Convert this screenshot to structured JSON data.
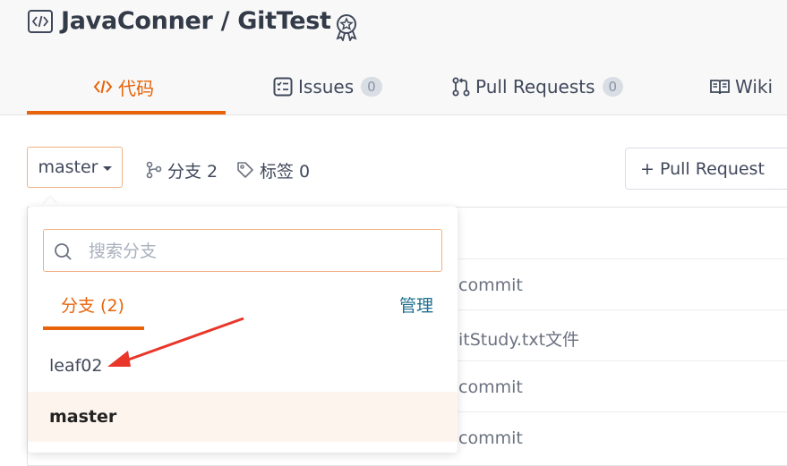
{
  "repo": {
    "title": "JavaConner / GitTest",
    "star_icon": "award-icon"
  },
  "tabs": [
    {
      "label": "代码",
      "icon": "code-icon",
      "active": true
    },
    {
      "label": "Issues",
      "count": "0",
      "icon": "issues-icon"
    },
    {
      "label": "Pull Requests",
      "count": "0",
      "icon": "pull-request-icon"
    },
    {
      "label": "Wiki",
      "icon": "book-icon"
    }
  ],
  "toolbar": {
    "branch_selected": "master",
    "branches_label": "分支 2",
    "tags_label": "标签 0",
    "pr_button": "+ Pull Request"
  },
  "dropdown": {
    "search_placeholder": "搜索分支",
    "tab_label": "分支 (2)",
    "manage_label": "管理",
    "branches": [
      "leaf02",
      "master"
    ],
    "active_branch": "master"
  },
  "commits": [
    {
      "message": "commit"
    },
    {
      "message": "itStudy.txt文件"
    },
    {
      "message": "commit"
    },
    {
      "message": "commit"
    }
  ],
  "colors": {
    "accent": "#e8630a",
    "annotation": "#e8362a"
  }
}
